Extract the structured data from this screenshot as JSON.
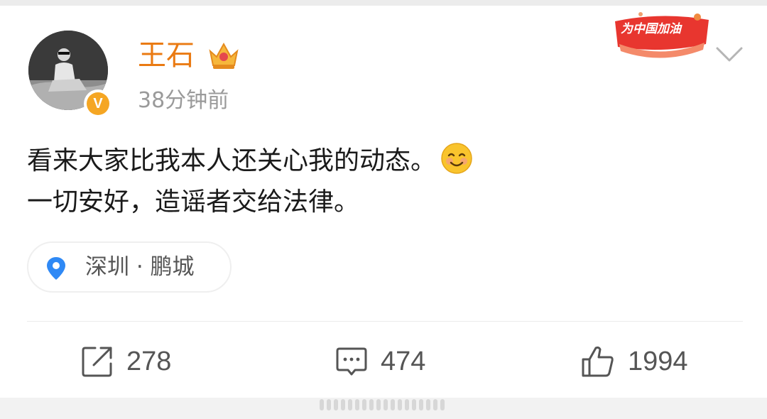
{
  "post": {
    "author": {
      "name": "王石",
      "verified_badge": "V"
    },
    "timestamp": "38分钟前",
    "promo_banner": "为中国加油",
    "content_lines": [
      "看来大家比我本人还关心我的动态。",
      "一切安好，造谣者交给法律。"
    ],
    "content_emoji": "smiling-face-icon",
    "location": "深圳 · 鹏城",
    "actions": {
      "repost_count": "278",
      "comment_count": "474",
      "like_count": "1994"
    }
  },
  "colors": {
    "username": "#ea7a12",
    "verified": "#f5a623",
    "pin": "#2f89f5",
    "promo": "#e8362f"
  }
}
